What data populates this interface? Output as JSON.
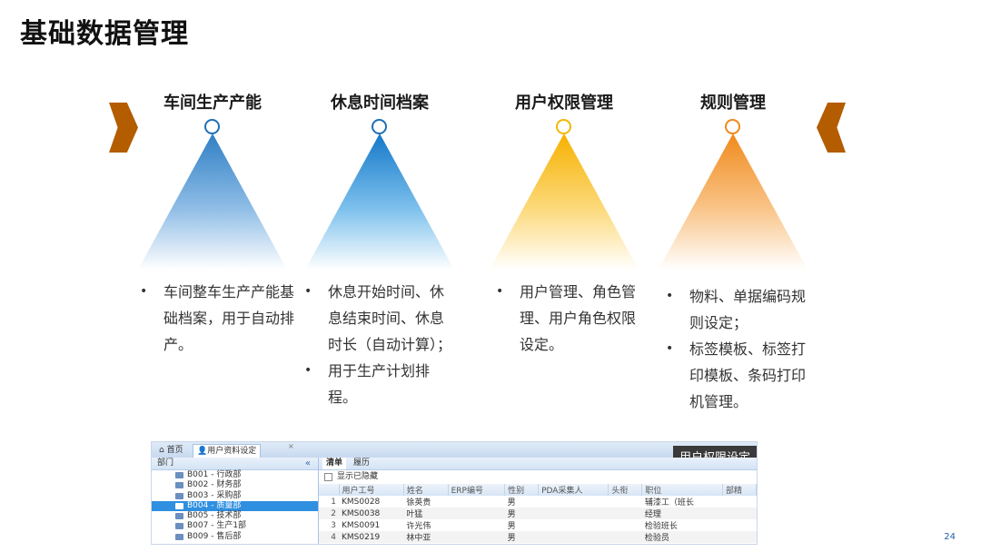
{
  "title": "基础数据管理",
  "columns": [
    {
      "heading": "车间生产产能",
      "color": "#1f6fb5",
      "bullets": [
        "车间整车生产产能基础档案，用于自动排产。"
      ]
    },
    {
      "heading": "休息时间档案",
      "color": "#1578c9",
      "bullets": [
        "休息开始时间、休息结束时间、休息时长（自动计算）；",
        "用于生产计划排程。"
      ]
    },
    {
      "heading": "用户权限管理",
      "color": "#f2b705",
      "bullets": [
        "用户管理、角色管理、用户角色权限设定。"
      ]
    },
    {
      "heading": "规则管理",
      "color": "#f08a1c",
      "bullets": [
        "物料、单据编码规则设定；",
        "标签模板、标签打印模板、条码打印机管理。"
      ]
    }
  ],
  "screenshot": {
    "label": "用户权限设定",
    "tabs": {
      "home": "首页",
      "active": "用户资料设定",
      "close": "×"
    },
    "dept_header": "部门",
    "collapse_icon": "«",
    "departments": [
      {
        "label": "B001 - 行政部",
        "selected": false
      },
      {
        "label": "B002 - 财务部",
        "selected": false
      },
      {
        "label": "B003 - 采购部",
        "selected": false
      },
      {
        "label": "B004 - 质量部",
        "selected": true
      },
      {
        "label": "B005 - 技术部",
        "selected": false
      },
      {
        "label": "B007 - 生产1部",
        "selected": false
      },
      {
        "label": "B009 - 售后部",
        "selected": false
      }
    ],
    "sub_tabs": [
      "清单",
      "履历"
    ],
    "show_hidden": "显示已隐藏",
    "table_headers": [
      "",
      "用户工号",
      "姓名",
      "ERP编号",
      "性别",
      "PDA采集人",
      "头衔",
      "职位",
      "部精"
    ],
    "rows": [
      [
        "1",
        "KMS0028",
        "徐英贵",
        "",
        "男",
        "",
        "",
        "辅漆工（班长",
        ""
      ],
      [
        "2",
        "KMS0038",
        "叶猛",
        "",
        "男",
        "",
        "",
        "经理",
        ""
      ],
      [
        "3",
        "KMS0091",
        "许光伟",
        "",
        "男",
        "",
        "",
        "检验班长",
        ""
      ],
      [
        "4",
        "KMS0219",
        "林中亚",
        "",
        "男",
        "",
        "",
        "检验员",
        ""
      ]
    ]
  },
  "page_number": "24"
}
